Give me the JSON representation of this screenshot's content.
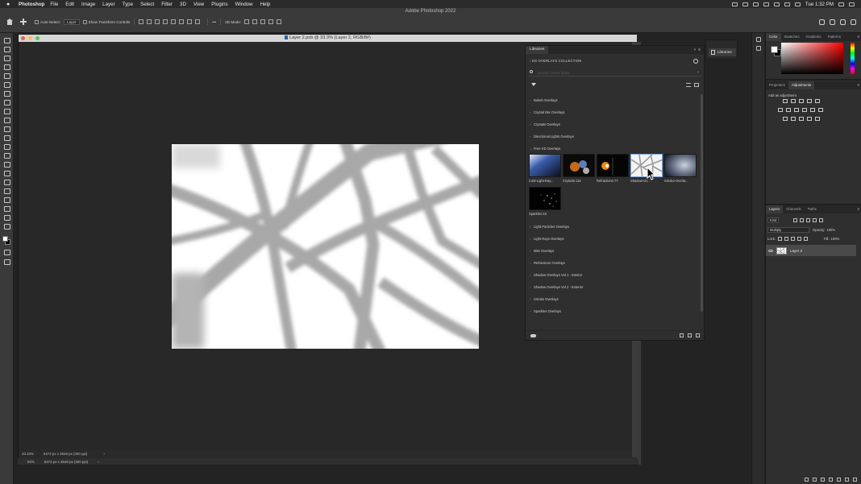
{
  "menubar": {
    "app_name": "Photoshop",
    "menus": [
      "File",
      "Edit",
      "Image",
      "Layer",
      "Type",
      "Select",
      "Filter",
      "3D",
      "View",
      "Plugins",
      "Window",
      "Help"
    ],
    "clock": "Tue 1:32 PM"
  },
  "window_title": "Adobe Photoshop 2022",
  "options": {
    "auto_select_label": "Auto-Select:",
    "auto_select_value": "Layer",
    "transform_label": "Show Transform Controls",
    "mode_3d_label": "3D Mode:"
  },
  "document": {
    "title": "Layer 2.psb @ 33.3% (Layer 2, RGB/8#)",
    "zoom": "33.33%",
    "size_info": "5472 px x 3648 px (300 ppi)",
    "zoom_under": "50%",
    "size_info_under": "5472 px x 3648 px (300 ppi)",
    "status_arrow": "›"
  },
  "libraries": {
    "tab": "Libraries",
    "collapse": "»",
    "menu": "≡",
    "back": "‹  KD OVERLAYS COLLECTION",
    "search_placeholder": "Search current library",
    "categories_top": [
      "Bokeh Overlays",
      "Crystal Mix Overlays",
      "Crystals Overlays",
      "Directional Lights Overlays"
    ],
    "open_category": "Free KD Overlays",
    "assets": [
      {
        "label": "Cold-Light-Ray..."
      },
      {
        "label": "Crystals-116"
      },
      {
        "label": "Refractions-77"
      },
      {
        "label": "Shadow-Ov..."
      },
      {
        "label": "Smoke-Overla..."
      },
      {
        "label": "Sparkles-16"
      }
    ],
    "categories_bottom": [
      "Light Particles Overlays",
      "Light Rays Overlays",
      "Mist Overlays",
      "Refractions Overlays",
      "Shadow Overlays Vol 1 - Interior",
      "Shadow Overlays Vol 2 - Exterior",
      "Smoke Overlays",
      "Sparkles Overlays"
    ],
    "collapsed_label": "Libraries",
    "caret_closed": "›",
    "caret_open": "⌄"
  },
  "color_panel": {
    "tabs": [
      "Color",
      "Swatches",
      "Gradients",
      "Patterns"
    ]
  },
  "adjust_panel": {
    "tabs": [
      "Properties",
      "Adjustments"
    ],
    "hint": "Add an adjustment"
  },
  "layers_panel": {
    "tabs": [
      "Layers",
      "Channels",
      "Paths"
    ],
    "kind": "Kind",
    "blend_mode": "Multiply",
    "opacity_label": "Opacity:",
    "opacity_value": "100%",
    "lock_label": "Lock:",
    "fill_label": "Fill:",
    "fill_value": "100%",
    "layer_name": "Layer 2"
  },
  "panel_menu": "≡"
}
